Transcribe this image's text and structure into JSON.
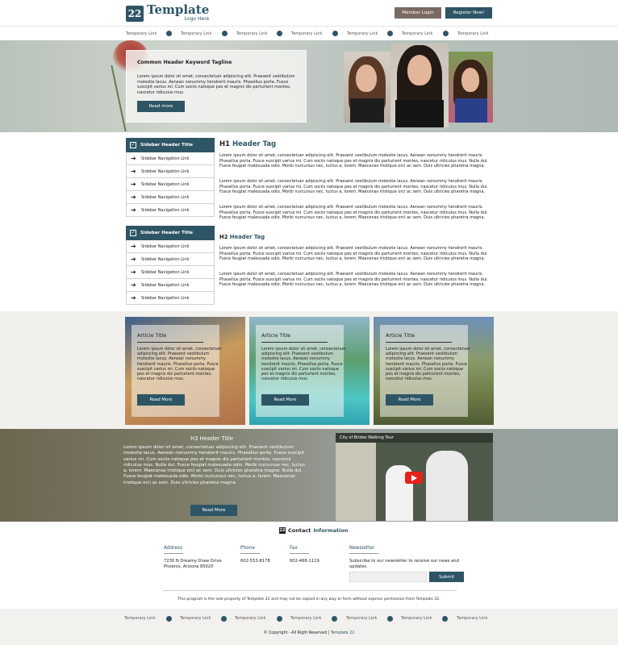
{
  "header": {
    "logo_mark": "22",
    "logo_title": "Template",
    "logo_subtitle": "Logo Here",
    "member_login": "Member Login",
    "register": "Register Now!"
  },
  "nav": {
    "links": [
      "Temporary Link",
      "Temporary Link",
      "Temporary Link",
      "Temporary Link",
      "Temporary Link",
      "Temporary Link",
      "Temporary Link"
    ]
  },
  "hero": {
    "tagline": "Common Header Keyword Tagline",
    "text": "Lorem ipsum dolor sit amet, consectetuer adipiscing elit. Praesent vestibulum molestie lacus. Aenean nonummy hendrerit mauris. Phasellus porta. Fusce suscipit varius mi. Cum sociis natoque pes et magnis dis parturient montes, nascetur ridiculus mus.",
    "button": "Read more"
  },
  "sidebar": {
    "blocks": [
      {
        "title": "Sidebar Header Title",
        "items": [
          "Sidebar Navigation Link",
          "Sidebar Navigation Link",
          "Sidebar Navigation Link",
          "Sidebar Navigation Link",
          "Sidebar Navigation Link"
        ]
      },
      {
        "title": "Sidebar Header Title",
        "items": [
          "Sidebar Navigation Link",
          "Sidebar Navigation Link",
          "Sidebar Navigation Link",
          "Sidebar Navigation Link",
          "Sidebar Navigation Link"
        ]
      }
    ]
  },
  "content": {
    "h1_prefix": "H1",
    "h1_text": "Header Tag",
    "h2_prefix": "H2",
    "h2_text": "Header Tag",
    "paragraphs": [
      "Lorem ipsum dolor sit amet, consectetuer adipiscing elit. Praesent vestibulum molestie lacus. Aenean nonummy hendrerit mauris. Phasellus porta. Fusce suscipit varius mi. Cum sociis natoque pes et magnis dis parturient montes, nascetur ridiculus mus. Nulla dui. Fusce feugiat malesuada odio. Morbi nurcursus nec, luctus a, lorem. Maecenas tristique orci ac sem. Duis ultricies pharetra magna.",
      "Lorem ipsum dolor sit amet, consectetuer adipiscing elit. Praesent vestibulum molestie lacus. Aenean nonummy hendrerit mauris. Phasellus porta. Fusce suscipit varius mi. Cum sociis natoque pes et magnis dis parturient montes, nascetur ridiculus mus. Nulla dui. Fusce feugiat malesuada odio. Morbi nurcursus nec, luctus a, lorem. Maecenas tristique orci ac sem. Duis ultricies pharetra magna.",
      "Lorem ipsum dolor sit amet, consectetuer adipiscing elit. Praesent vestibulum molestie lacus. Aenean nonummy hendrerit mauris. Phasellus porta. Fusce suscipit varius mi. Cum sociis natoque pes et magnis dis parturient montes, nascetur ridiculus mus. Nulla dui. Fusce feugiat malesuada odio. Morbi nurcursus nec, luctus a, lorem. Maecenas tristique orci ac sem. Duis ultricies pharetra magna.",
      "Lorem ipsum dolor sit amet, consectetuer adipiscing elit. Praesent vestibulum molestie lacus. Aenean nonummy hendrerit mauris. Phasellus porta. Fusce suscipit varius mi. Cum sociis natoque pes et magnis dis parturient montes, nascetur ridiculus mus. Nulla dui. Fusce feugiat malesuada odio. Morbi nurcursus nec, luctus a, lorem. Maecenas tristique orci ac sem. Duis ultricies pharetra magna.",
      "Lorem ipsum dolor sit amet, consectetuer adipiscing elit. Praesent vestibulum molestie lacus. Aenean nonummy hendrerit mauris. Phasellus porta. Fusce suscipit varius mi. Cum sociis natoque pes et magnis dis parturient montes, nascetur ridiculus mus. Nulla dui. Fusce feugiat malesuada odio. Morbi nurcursus nec, luctus a, lorem. Maecenas tristique orci ac sem. Duis ultricies pharetra magna."
    ]
  },
  "articles": [
    {
      "title": "Article Title",
      "text": "Lorem ipsum dolor sit amet, consectetuer adipiscing elit. Praesent vestibulum molestie lacus. Aenean nonummy hendrerit mauris. Phasellus porta. Fusce suscipit varius mi. Cum sociis natoque pes et magnis dis parturient montes, nascetur ridiculus mus.",
      "button": "Read More"
    },
    {
      "title": "Article Title",
      "text": "Lorem ipsum dolor sit amet, consectetuer adipiscing elit. Praesent vestibulum molestie lacus. Aenean nonummy hendrerit mauris. Phasellus porta. Fusce suscipit varius mi. Cum sociis natoque pes et magnis dis parturient montes, nascetur ridiculus mus.",
      "button": "Read More"
    },
    {
      "title": "Article Title",
      "text": "Lorem ipsum dolor sit amet, consectetuer adipiscing elit. Praesent vestibulum molestie lacus. Aenean nonummy hendrerit mauris. Phasellus porta. Fusce suscipit varius mi. Cum sociis natoque pes et magnis dis parturient montes, nascetur ridiculus mus.",
      "button": "Read More"
    }
  ],
  "h3section": {
    "title": "H3 Header Title",
    "text": "Lorem ipsum dolor sit amet, consectetuer adipiscing elit. Praesent vestibulum molestie lacus. Aenean nonummy hendrerit mauris. Phasellus porta. Fusce suscipit varius mi. Cum sociis natoque pes et magnis dis parturient montes, nascetur ridiculus mus. Nulla dui. Fusce feugiat malesuada odio. Morbi nurcursus nec, luctus a, lorem. Maecenas tristique orci ac sem. Duis ultricies pharetra magna. Nulla dui. Fusce feugiat malesuada odio. Morbi nurcursus nec, luctus a, lorem. Maecenas tristique orci ac sem. Duis ultricies pharetra magna.",
    "button": "Read More",
    "video_title": "City of Brides Walking Tour"
  },
  "contact": {
    "title_a": "Contact",
    "title_b": "Information",
    "address_label": "Address",
    "address_line1": "7230 N Dreamy Draw Drive",
    "address_line2": "Phoenix, Arizona 85020",
    "phone_label": "Phone",
    "phone": "602-553-8178",
    "fax_label": "Fax",
    "fax": "602-468-1119",
    "newsletter_label": "Newsletter",
    "newsletter_text": "Subscribe to our newsletter to receive our news and updates.",
    "newsletter_placeholder": "",
    "submit": "Submit",
    "legal": "This program is the sole property of Template 22 and may not be copied in any way or form without express permission from Template 22."
  },
  "footer": {
    "links": [
      "Temporary Link",
      "Temporary Link",
      "Temporary Link",
      "Temporary Link",
      "Temporary Link",
      "Temporary Link",
      "Temporary Link"
    ],
    "copyright_prefix": "© Copyright - All Right Reserved |",
    "copyright_brand": "Template 22"
  },
  "colors": {
    "accent": "#2e5566",
    "member_button": "#7a6a64",
    "hero_bg": "#c4ccc4",
    "articles_bg": "#f1f0ec",
    "footer_bg": "#f2f1ee"
  }
}
